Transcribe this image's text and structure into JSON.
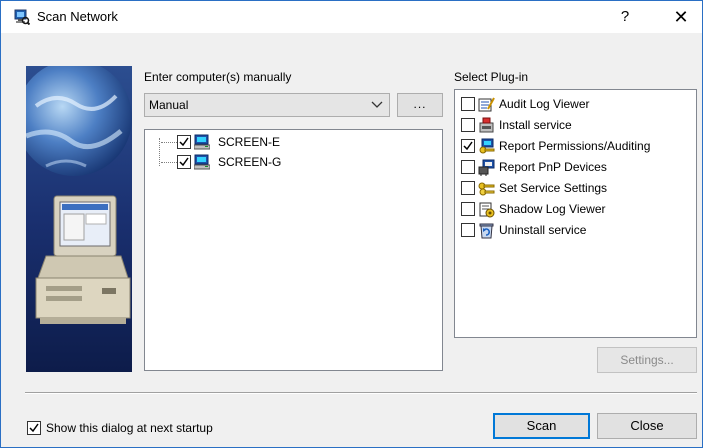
{
  "window": {
    "title": "Scan Network",
    "help_label": "?",
    "close_label": "✕"
  },
  "computers": {
    "label": "Enter computer(s) manually",
    "combo_value": "Manual",
    "browse_label": "...",
    "items": [
      {
        "name": "SCREEN-E",
        "checked": true
      },
      {
        "name": "SCREEN-G",
        "checked": true
      }
    ]
  },
  "plugins": {
    "label": "Select Plug-in",
    "items": [
      {
        "name": "Audit Log Viewer",
        "checked": false,
        "icon": "notepad-icon"
      },
      {
        "name": "Install service",
        "checked": false,
        "icon": "install-icon"
      },
      {
        "name": "Report Permissions/Auditing",
        "checked": true,
        "icon": "key-report-icon"
      },
      {
        "name": "Report PnP Devices",
        "checked": false,
        "icon": "pnp-devices-icon"
      },
      {
        "name": "Set Service Settings",
        "checked": false,
        "icon": "keys-icon"
      },
      {
        "name": "Shadow Log Viewer",
        "checked": false,
        "icon": "shadow-log-icon"
      },
      {
        "name": "Uninstall service",
        "checked": false,
        "icon": "uninstall-icon"
      }
    ],
    "settings_label": "Settings..."
  },
  "footer": {
    "startup_label": "Show this dialog at next startup",
    "startup_checked": true,
    "scan_label": "Scan",
    "close_label": "Close"
  },
  "colors": {
    "accent": "#0078d7",
    "window_border": "#2a6fc4",
    "dialog_bg": "#f0f0f0"
  }
}
